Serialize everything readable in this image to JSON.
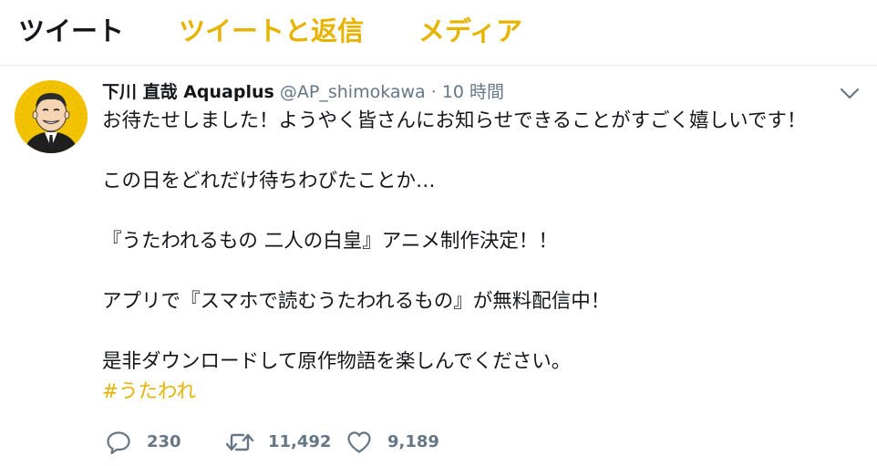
{
  "tabs": [
    {
      "label": "ツイート"
    },
    {
      "label": "ツイートと返信"
    },
    {
      "label": "メディア"
    }
  ],
  "tweet": {
    "author_name": "下川 直哉 Aquaplus",
    "handle": "@AP_shimokawa",
    "separator": "·",
    "time": "10 時間",
    "lines": [
      "お待たせしました！ようやく皆さんにお知らせできることがすごく嬉しいです！",
      "この日をどれだけ待ちわびたことか…",
      "『うたわれるもの 二人の白皇』アニメ制作決定！！",
      "アプリで『スマホで読むうたわれるもの』が無料配信中！",
      "是非ダウンロードして原作物語を楽しんでください。"
    ],
    "hashtag": "#うたわれ",
    "replies": "230",
    "retweets": "11,492",
    "likes": "9,189"
  },
  "icons": {
    "reply": "reply-icon",
    "retweet": "retweet-icon",
    "like": "heart-icon",
    "menu": "chevron-down-icon"
  },
  "colors": {
    "accent": "#e6b400",
    "text": "#14171a",
    "muted": "#657786",
    "avatar_bg": "#f2c200"
  }
}
